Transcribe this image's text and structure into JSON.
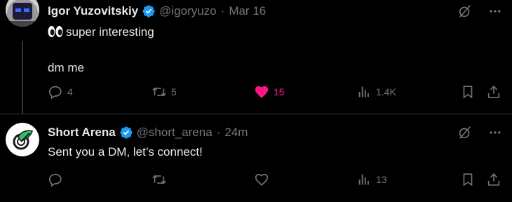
{
  "colors": {
    "background": "#000000",
    "text": "#e7e9ea",
    "muted": "#71767b",
    "verified": "#1d9bf0",
    "like": "#f91880",
    "divider": "#2f3336"
  },
  "tweets": [
    {
      "author_name": "Igor Yuzovitskiy",
      "handle": "@igoryuzo",
      "separator": "·",
      "time": "Mar 16",
      "body_line1": "super interesting",
      "body_line2": "dm me",
      "replies": "4",
      "retweets": "5",
      "likes": "15",
      "liked": true,
      "views": "1.4K",
      "icons": [
        "grok-icon",
        "more-icon",
        "reply-icon",
        "retweet-icon",
        "heart-filled-icon",
        "views-icon",
        "bookmark-icon",
        "share-icon",
        "eyes-emoji"
      ]
    },
    {
      "author_name": "Short Arena",
      "handle": "@short_arena",
      "separator": "·",
      "time": "24m",
      "body_line1": "Sent you a DM, let’s connect!",
      "replies": "",
      "retweets": "",
      "likes": "",
      "liked": false,
      "views": "13",
      "icons": [
        "grok-icon",
        "more-icon",
        "reply-icon",
        "retweet-icon",
        "heart-icon",
        "views-icon",
        "bookmark-icon",
        "share-icon"
      ]
    }
  ]
}
